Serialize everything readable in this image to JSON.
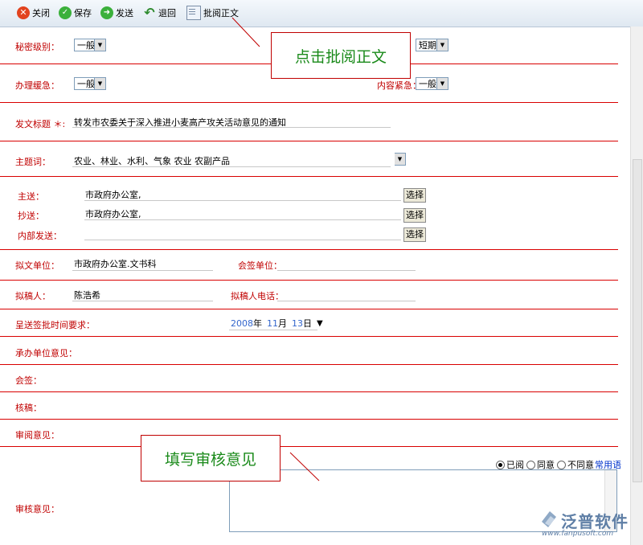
{
  "toolbar": {
    "close": "关闭",
    "save": "保存",
    "send": "发送",
    "back": "退回",
    "review": "批阅正文"
  },
  "form": {
    "secret_label": "秘密级别：",
    "secret_value": "一般",
    "period_value": "短期",
    "urgency_label": "办理缓急：",
    "urgency_value": "一般",
    "content_urgency_label": "内容紧急：",
    "content_urgency_value": "一般",
    "title_label": "发文标题 ＊:",
    "title_value": "转发市农委关于深入推进小麦高产攻关活动意见的通知",
    "subject_label": "主题词：",
    "subject_value": "农业、林业、水利、气象 农业 农副产品",
    "main_send_label": "主送：",
    "main_send_value": "市政府办公室,",
    "cc_label": "抄送：",
    "cc_value": "市政府办公室,",
    "internal_label": "内部发送：",
    "select_btn": "选择",
    "draft_unit_label": "拟文单位：",
    "draft_unit_value": "市政府办公室.文书科",
    "cosign_unit_label": "会签单位：",
    "drafter_label": "拟稿人：",
    "drafter_value": "陈浩希",
    "drafter_phone_label": "拟稿人电话：",
    "deadline_label": "呈送签批时间要求：",
    "date_year": "2008",
    "date_year_unit": "年",
    "date_month": "11",
    "date_month_unit": "月",
    "date_day": "13",
    "date_day_unit": "日",
    "undertake_label": "承办单位意见：",
    "cosign_label": "会签：",
    "check_label": "核稿：",
    "read_opinion_label": "审阅意见：",
    "review_opinion_label": "审核意见：",
    "radio_read": "已阅",
    "radio_agree": "同意",
    "radio_disagree": "不同意",
    "common_phrases": "常用语"
  },
  "callouts": {
    "top": "点击批阅正文",
    "bottom": "填写审核意见"
  },
  "logo": {
    "name": "泛普软件",
    "url": "www.fanpusoft.com"
  },
  "colors": {
    "label_red": "#c00000",
    "rule_red": "#d90000",
    "callout_green": "#1a8a1a",
    "date_blue": "#3366cc"
  }
}
